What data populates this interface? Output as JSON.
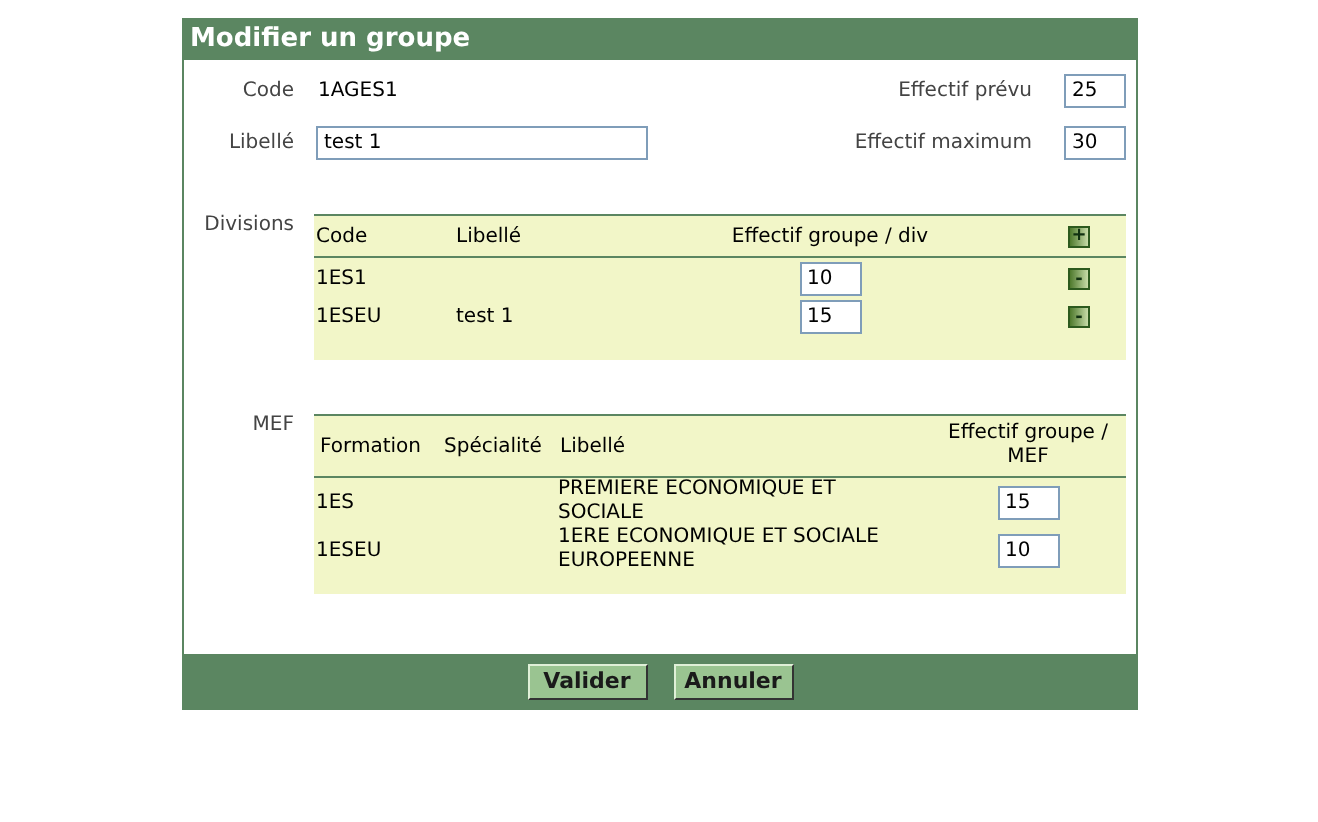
{
  "window": {
    "title": "Modifier un groupe"
  },
  "fields": {
    "code_label": "Code",
    "code_value": "1AGES1",
    "libelle_label": "Libellé",
    "libelle_value": "test 1",
    "prevu_label": "Effectif prévu",
    "prevu_value": "25",
    "max_label": "Effectif maximum",
    "max_value": "30"
  },
  "divisions": {
    "label": "Divisions",
    "columns": [
      "Code",
      "Libellé",
      "Effectif groupe / div"
    ],
    "add_button": "+",
    "rows": [
      {
        "code": "1ES1",
        "libelle": "",
        "effectif": "10",
        "remove_button": "-"
      },
      {
        "code": "1ESEU",
        "libelle": "test 1",
        "effectif": "15",
        "remove_button": "-"
      }
    ]
  },
  "mef": {
    "label": "MEF",
    "columns": [
      "Formation",
      "Spécialité",
      "Libellé",
      "Effectif groupe / MEF"
    ],
    "rows": [
      {
        "formation": "1ES",
        "specialite": "",
        "libelle": "PREMIERE ECONOMIQUE ET SOCIALE",
        "effectif": "15"
      },
      {
        "formation": "1ESEU",
        "specialite": "",
        "libelle": "1ERE ECONOMIQUE ET SOCIALE EUROPEENNE",
        "effectif": "10"
      }
    ]
  },
  "buttons": [
    "Valider",
    "Annuler"
  ]
}
